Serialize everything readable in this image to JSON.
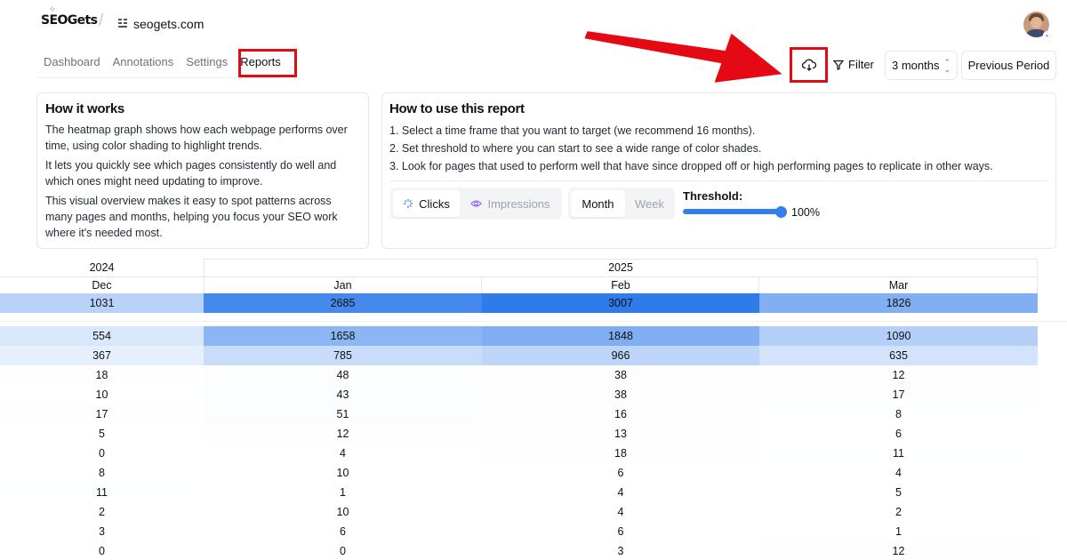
{
  "brand": {
    "logo": "SEOGets"
  },
  "site": {
    "name": "seogets.com"
  },
  "nav": [
    "Dashboard",
    "Annotations",
    "Settings",
    "Reports"
  ],
  "toolbar": {
    "filter": "Filter",
    "range": "3 months",
    "compare": "Previous Period",
    "download_icon": "cloud-download-icon"
  },
  "how_it_works": {
    "title": "How it works",
    "paragraphs": [
      "The heatmap graph shows how each webpage performs over time, using color shading to highlight trends.",
      "It lets you quickly see which pages consistently do well and which ones might need updating to improve.",
      "This visual overview makes it easy to spot patterns across many pages and months, helping you focus your SEO work where it's needed most."
    ]
  },
  "how_to_use": {
    "title": "How to use this report",
    "steps": [
      "1. Select a time frame that you want to target (we recommend 16 months).",
      "2. Set threshold to where you can start to see a wide range of color shades.",
      "3. Look for pages that used to perform well that have since dropped off or high performing pages to replicate in other ways."
    ]
  },
  "controls": {
    "metric": {
      "selected": "Clicks",
      "other": "Impressions"
    },
    "period": {
      "selected": "Month",
      "other": "Week"
    },
    "threshold": {
      "label": "Threshold:",
      "value": "100%",
      "fraction": 1.0
    }
  },
  "heatmap": {
    "years": [
      "2024",
      "2025"
    ],
    "months": [
      "Dec",
      "Jan",
      "Feb",
      "Mar"
    ],
    "total_row": [
      "1031",
      "2685",
      "3007",
      "1826"
    ],
    "rows": [
      [
        "554",
        "1658",
        "1848",
        "1090"
      ],
      [
        "367",
        "785",
        "966",
        "635"
      ],
      [
        "18",
        "48",
        "38",
        "12"
      ],
      [
        "10",
        "43",
        "38",
        "17"
      ],
      [
        "17",
        "51",
        "16",
        "8"
      ],
      [
        "5",
        "12",
        "13",
        "6"
      ],
      [
        "0",
        "4",
        "18",
        "11"
      ],
      [
        "8",
        "10",
        "6",
        "4"
      ],
      [
        "11",
        "1",
        "4",
        "5"
      ],
      [
        "2",
        "10",
        "4",
        "2"
      ],
      [
        "3",
        "6",
        "6",
        "1"
      ],
      [
        "0",
        "0",
        "3",
        "12"
      ]
    ],
    "colors": {
      "max": "#2f7bea",
      "min": "#ffffff"
    }
  }
}
